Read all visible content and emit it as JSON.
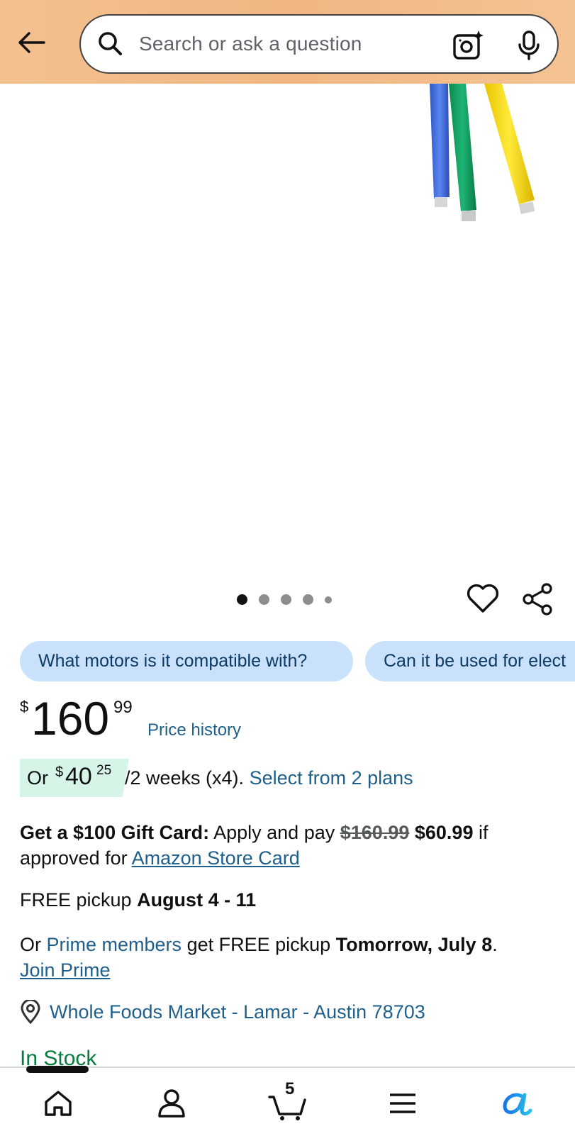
{
  "header": {
    "search_placeholder": "Search or ask a question",
    "icons": [
      "back-arrow-icon",
      "search-icon",
      "camera-lens-icon",
      "microphone-icon"
    ]
  },
  "gallery": {
    "current_image": 1,
    "total_images": 5
  },
  "chips": [
    {
      "label": "What motors is it compatible with?"
    },
    {
      "label": "Can it be used for elect"
    }
  ],
  "price": {
    "symbol": "$",
    "whole": "160",
    "fraction": "99",
    "history_label": "Price history"
  },
  "installment": {
    "or": "Or",
    "symbol": "$",
    "whole": "40",
    "fraction": "25",
    "terms": "/2 weeks (x4).",
    "plans_link": "Select from 2 plans"
  },
  "gift_card": {
    "bold": "Get a $100 Gift Card:",
    "text1": "Apply and pay",
    "old_price": "$160.99",
    "new_price": "$60.99",
    "text2": "if approved for",
    "card_link": "Amazon Store Card"
  },
  "pickup": {
    "label": "FREE pickup",
    "dates": "August 4 - 11"
  },
  "prime": {
    "or": "Or",
    "members_link": "Prime members",
    "text": "get FREE pickup",
    "date": "Tomorrow, July 8",
    "period": ".",
    "join_link": "Join Prime"
  },
  "location": {
    "store": "Whole Foods Market - Lamar - Austin 78703"
  },
  "stock": {
    "status": "In Stock"
  },
  "bottom_nav": {
    "cart_count": "5",
    "items": [
      "home-icon",
      "account-icon",
      "cart-icon",
      "menu-icon",
      "rufus-icon"
    ]
  },
  "colors": {
    "header_bg": "#efb681",
    "chip_bg": "#c9e1fb",
    "link": "#1f5f8b",
    "in_stock": "#067d3f",
    "installment_bg": "#d6f5e6"
  }
}
